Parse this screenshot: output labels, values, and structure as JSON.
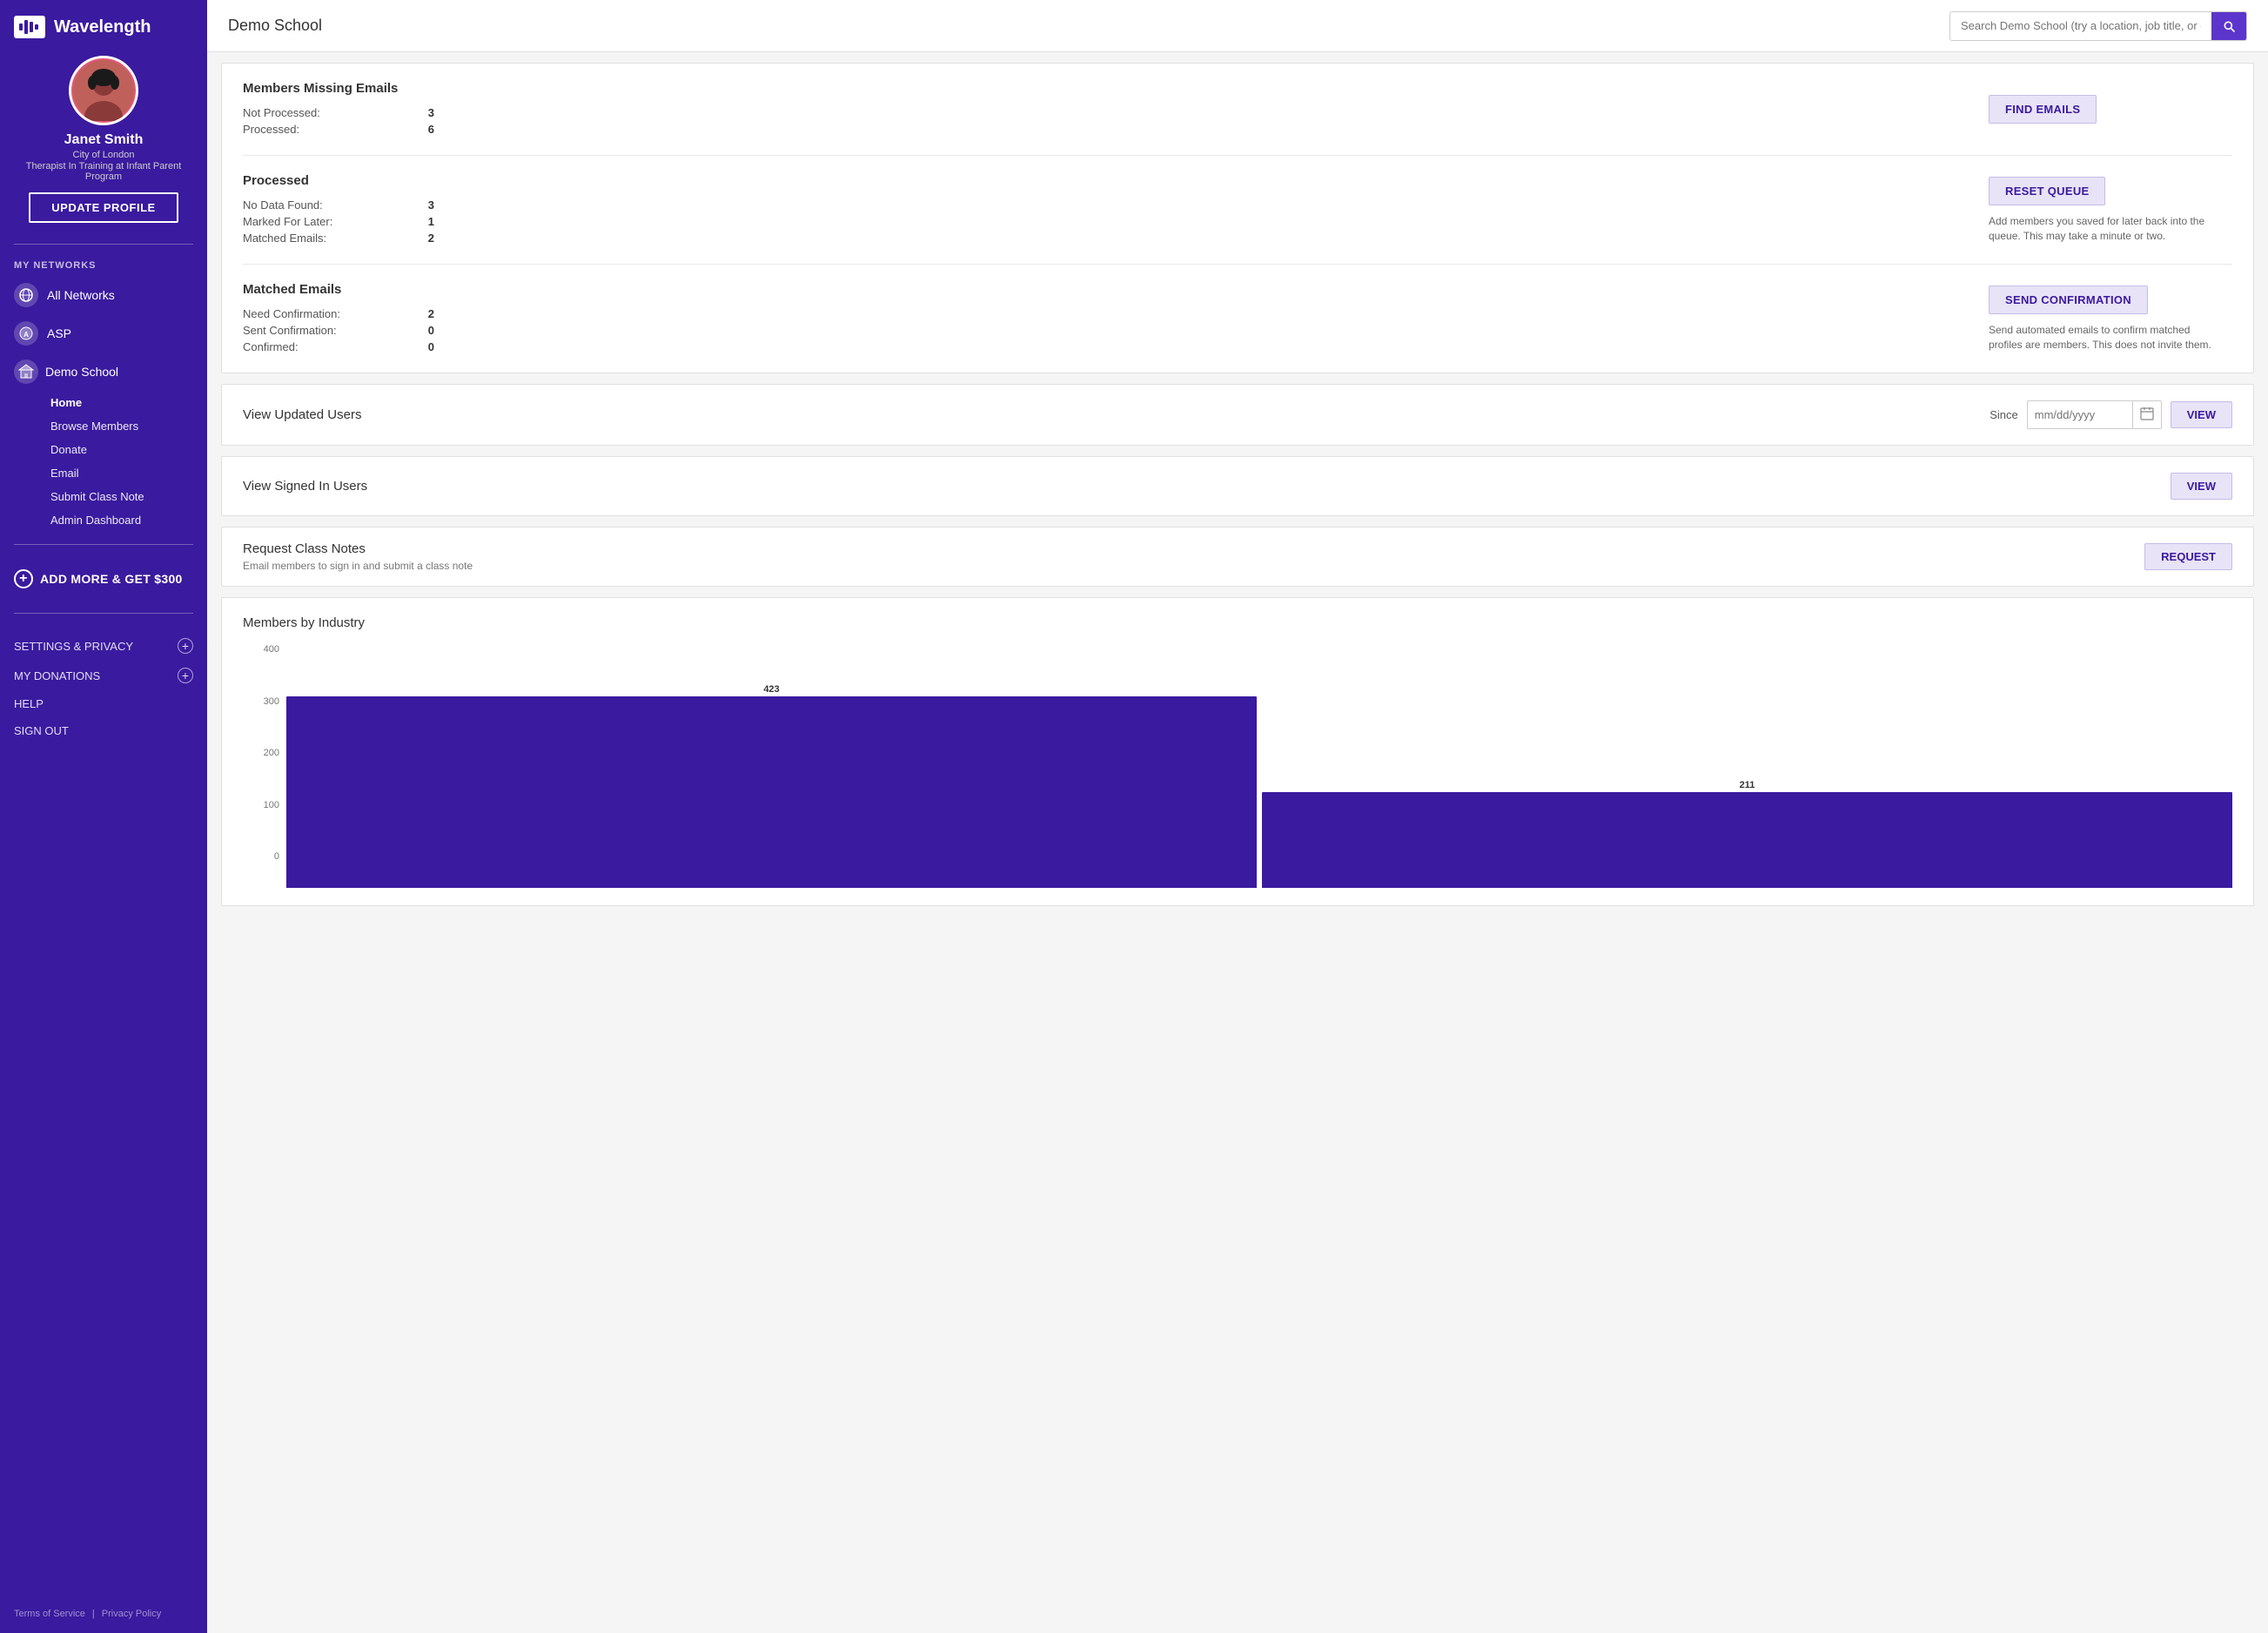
{
  "app": {
    "name": "Wavelength"
  },
  "sidebar": {
    "user": {
      "name": "Janet Smith",
      "location": "City of London",
      "title": "Therapist In Training at Infant Parent Program"
    },
    "update_profile_label": "UPDATE PROFILE",
    "my_networks_label": "MY NETWORKS",
    "networks": [
      {
        "id": "all",
        "label": "All Networks",
        "icon": "🌐"
      },
      {
        "id": "asp",
        "label": "ASP",
        "icon": "A"
      }
    ],
    "school": {
      "label": "Demo School",
      "icon": "🏫"
    },
    "nav_items": [
      {
        "id": "home",
        "label": "Home",
        "active": true
      },
      {
        "id": "browse",
        "label": "Browse Members"
      },
      {
        "id": "donate",
        "label": "Donate"
      },
      {
        "id": "email",
        "label": "Email"
      },
      {
        "id": "classNote",
        "label": "Submit Class Note"
      },
      {
        "id": "admin",
        "label": "Admin Dashboard"
      }
    ],
    "add_more_label": "ADD MORE & GET $300",
    "footer": {
      "settings_label": "SETTINGS & PRIVACY",
      "donations_label": "MY DONATIONS",
      "help_label": "HELP",
      "signout_label": "SIGN OUT"
    },
    "bottom_links": {
      "terms": "Terms of Service",
      "separator": "|",
      "privacy": "Privacy Policy"
    }
  },
  "topbar": {
    "title": "Demo School",
    "search_placeholder": "Search Demo School (try a location, job title, or company)"
  },
  "missing_emails": {
    "title": "Members Missing Emails",
    "not_processed_label": "Not Processed:",
    "not_processed_value": "3",
    "processed_label": "Processed:",
    "processed_value": "6",
    "find_emails_btn": "FIND EMAILS"
  },
  "processed": {
    "title": "Processed",
    "no_data_label": "No Data Found:",
    "no_data_value": "3",
    "marked_later_label": "Marked For Later:",
    "marked_later_value": "1",
    "matched_emails_label": "Matched Emails:",
    "matched_emails_value": "2",
    "reset_queue_btn": "RESET QUEUE",
    "reset_queue_desc": "Add members you saved for later back into the queue. This may take a minute or two."
  },
  "matched_emails": {
    "title": "Matched Emails",
    "need_confirmation_label": "Need Confirmation:",
    "need_confirmation_value": "2",
    "sent_confirmation_label": "Sent Confirmation:",
    "sent_confirmation_value": "0",
    "confirmed_label": "Confirmed:",
    "confirmed_value": "0",
    "send_confirmation_btn": "SEND CONFIRMATION",
    "send_confirmation_desc": "Send automated emails to confirm matched profiles are members. This does not invite them."
  },
  "view_updated": {
    "title": "View Updated Users",
    "since_label": "Since",
    "date_placeholder": "mm/dd/yyyy",
    "view_btn": "VIEW"
  },
  "view_signed_in": {
    "title": "View Signed In Users",
    "view_btn": "VIEW"
  },
  "request_class_notes": {
    "title": "Request Class Notes",
    "desc": "Email members to sign in and submit a class note",
    "request_btn": "REQUEST"
  },
  "chart": {
    "title": "Members by Industry",
    "y_labels": [
      "400",
      "300",
      "200",
      "100",
      "0"
    ],
    "bars": [
      {
        "label": "",
        "value": 423,
        "height_pct": 100
      },
      {
        "label": "",
        "value": 211,
        "height_pct": 50
      }
    ]
  }
}
